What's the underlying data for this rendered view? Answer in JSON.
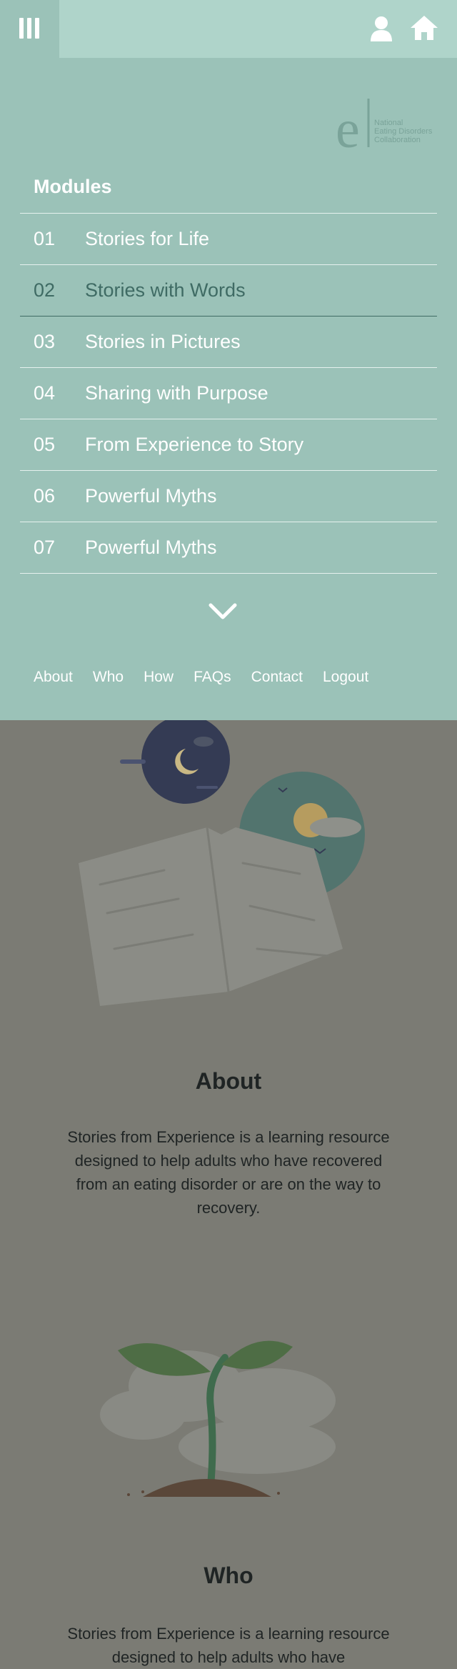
{
  "header": {
    "menu_icon": "menu-icon",
    "user_icon": "user-icon",
    "home_icon": "home-icon"
  },
  "logo": {
    "mark": "e",
    "lines": [
      "National",
      "Eating Disorders",
      "Collaboration"
    ]
  },
  "modules": {
    "title": "Modules",
    "items": [
      {
        "num": "01",
        "label": "Stories for Life",
        "active": false
      },
      {
        "num": "02",
        "label": "Stories with Words",
        "active": true
      },
      {
        "num": "03",
        "label": "Stories in Pictures",
        "active": false
      },
      {
        "num": "04",
        "label": "Sharing with Purpose",
        "active": false
      },
      {
        "num": "05",
        "label": "From Experience to Story",
        "active": false
      },
      {
        "num": "06",
        "label": "Powerful Myths",
        "active": false
      },
      {
        "num": "07",
        "label": "Powerful Myths",
        "active": false
      }
    ],
    "expand_icon": "chevron-down-icon"
  },
  "footer_nav": [
    "About",
    "Who",
    "How",
    "FAQs",
    "Contact",
    "Logout"
  ],
  "sections": {
    "about": {
      "heading": "About",
      "text": "Stories from Experience is a learning resource designed to help adults who have recovered from an eating disorder or are on the way to recovery."
    },
    "who": {
      "heading": "Who",
      "text": "Stories from Experience is a learning resource designed to help adults who have"
    }
  },
  "colors": {
    "overlay": "#9bc2b8",
    "topbar": "#afd4ca",
    "active_item": "#3f6b64",
    "page_dim": "#7b7b74"
  }
}
